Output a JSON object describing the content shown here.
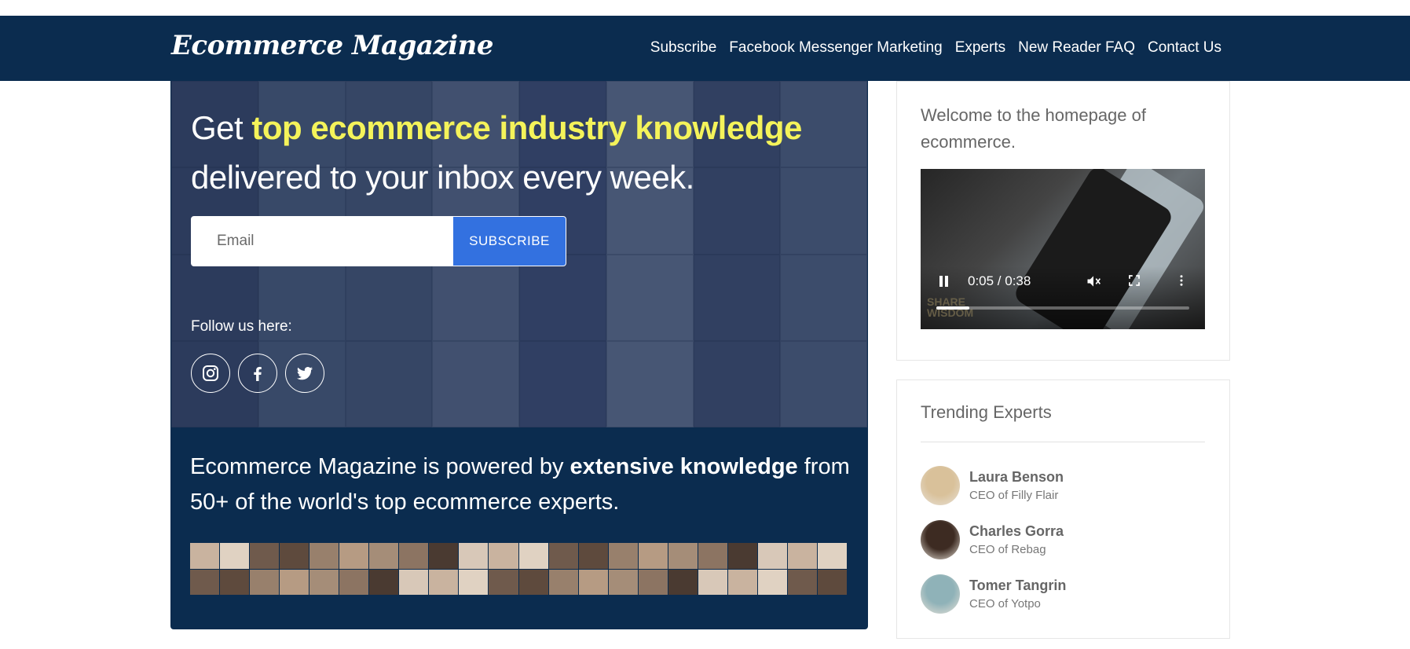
{
  "header": {
    "logo": "Ecommerce Magazine",
    "nav": [
      "Subscribe",
      "Facebook Messenger Marketing",
      "Experts",
      "New Reader FAQ",
      "Contact Us"
    ]
  },
  "hero": {
    "headline_prefix": "Get ",
    "headline_highlight": "top ecommerce industry knowledge",
    "headline_suffix": " delivered to your inbox every week.",
    "email_placeholder": "Email",
    "subscribe_label": "SUBSCRIBE",
    "follow_label": "Follow us here:",
    "socials": [
      "instagram-icon",
      "facebook-icon",
      "twitter-icon"
    ]
  },
  "lower": {
    "text_prefix": "Ecommerce Magazine is powered by ",
    "text_bold": "extensive knowledge",
    "text_suffix": " from 50+ of the world's top ecommerce experts."
  },
  "sidebar": {
    "welcome": "Welcome to the homepage of ecommerce.",
    "video": {
      "time": "0:05 / 0:38",
      "progress": 0.13,
      "watermark_line1": "SHARE",
      "watermark_line2": "WISDOM"
    },
    "trending_title": "Trending Experts",
    "experts": [
      {
        "name": "Laura Benson",
        "role": "CEO of Filly Flair",
        "avatar_color": "#d9c19a"
      },
      {
        "name": "Charles Gorra",
        "role": "CEO of Rebag",
        "avatar_color": "#3d2b22"
      },
      {
        "name": "Tomer Tangrin",
        "role": "CEO of Yotpo",
        "avatar_color": "#8fb2b8"
      }
    ]
  },
  "colors": {
    "header_bg": "#0b2c4f",
    "accent": "#3371e0",
    "highlight": "#f4f35a"
  }
}
